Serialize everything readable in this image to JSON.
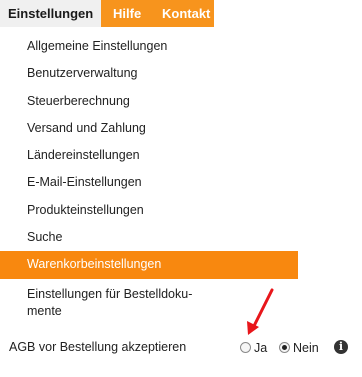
{
  "menubar": {
    "tabs": [
      {
        "label": "Einstellungen"
      },
      {
        "label": "Hilfe"
      },
      {
        "label": "Kontakt"
      }
    ]
  },
  "dropdown": {
    "items": [
      {
        "label": "Allgemeine Einstellungen"
      },
      {
        "label": "Benutzerverwaltung"
      },
      {
        "label": "Steuerberechnung"
      },
      {
        "label": "Versand und Zahlung"
      },
      {
        "label": "Ländereinstellungen"
      },
      {
        "label": "E-Mail-Einstellungen"
      },
      {
        "label": "Produkteinstellungen"
      },
      {
        "label": "Suche"
      },
      {
        "label": "Warenkorbeinstellungen"
      },
      {
        "label_line1": "Einstellungen für Bestelldoku-",
        "label_line2": "mente"
      }
    ],
    "selected_index": 8
  },
  "setting": {
    "label": "AGB vor Bestellung akzeptieren",
    "option_yes": "Ja",
    "option_no": "Nein",
    "selected": "Nein",
    "info_glyph": "i"
  },
  "colors": {
    "accent_orange": "#f8880f",
    "annotation_red": "#e8161b"
  }
}
